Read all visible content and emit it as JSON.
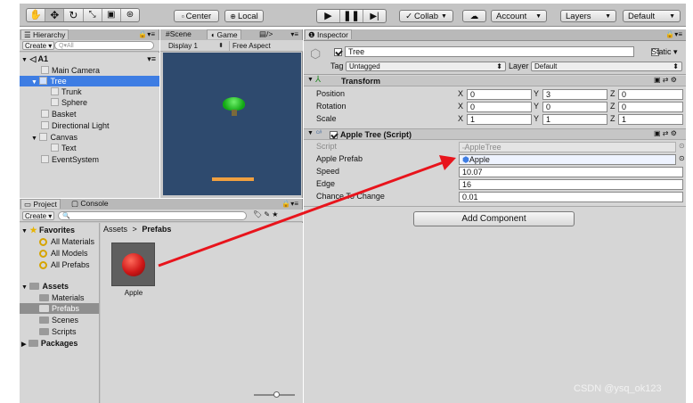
{
  "toolbar": {
    "center_label": "Center",
    "local_label": "Local",
    "collab_label": "Collab",
    "account_label": "Account",
    "layers_label": "Layers",
    "layout_label": "Default"
  },
  "hierarchy": {
    "tab_label": "Hierarchy",
    "create_label": "Create",
    "search_placeholder": "Q▾All",
    "scene_name": "A1",
    "items": [
      {
        "label": "Main Camera"
      },
      {
        "label": "Tree"
      },
      {
        "label": "Trunk"
      },
      {
        "label": "Sphere"
      },
      {
        "label": "Basket"
      },
      {
        "label": "Directional Light"
      },
      {
        "label": "Canvas"
      },
      {
        "label": "Text"
      },
      {
        "label": "EventSystem"
      }
    ]
  },
  "view": {
    "scene_tab": "Scene",
    "game_tab": "Game",
    "display_label": "Display 1",
    "aspect_label": "Free Aspect"
  },
  "project": {
    "project_tab": "Project",
    "console_tab": "Console",
    "create_label": "Create",
    "favorites_label": "Favorites",
    "favorites": [
      "All Materials",
      "All Models",
      "All Prefabs"
    ],
    "assets_label": "Assets",
    "asset_folders": [
      "Materials",
      "Prefabs",
      "Scenes",
      "Scripts"
    ],
    "packages_label": "Packages",
    "breadcrumb_root": "Assets",
    "breadcrumb_sep": ">",
    "breadcrumb_current": "Prefabs",
    "asset_item": "Apple"
  },
  "inspector": {
    "tab_label": "Inspector",
    "object_name": "Tree",
    "static_label": "Static",
    "tag_label": "Tag",
    "tag_value": "Untagged",
    "layer_label": "Layer",
    "layer_value": "Default",
    "transform": {
      "title": "Transform",
      "rows": [
        {
          "label": "Position",
          "x": "0",
          "y": "3",
          "z": "0"
        },
        {
          "label": "Rotation",
          "x": "0",
          "y": "0",
          "z": "0"
        },
        {
          "label": "Scale",
          "x": "1",
          "y": "1",
          "z": "1"
        }
      ],
      "axis_x": "X",
      "axis_y": "Y",
      "axis_z": "Z"
    },
    "script": {
      "title": "Apple Tree (Script)",
      "script_label": "Script",
      "script_value": "AppleTree",
      "prefab_label": "Apple Prefab",
      "prefab_value": "Apple",
      "speed_label": "Speed",
      "speed_value": "10.07",
      "edge_label": "Edge",
      "edge_value": "16",
      "chance_label": "Chance To Change",
      "chance_value": "0.01"
    },
    "add_component_label": "Add Component"
  },
  "watermark": "CSDN @ysq_ok123",
  "colors": {
    "arrow": "#e8141c",
    "selection": "#3e7de3",
    "game_bg": "#2e4a6e",
    "apple": "#d01818"
  }
}
